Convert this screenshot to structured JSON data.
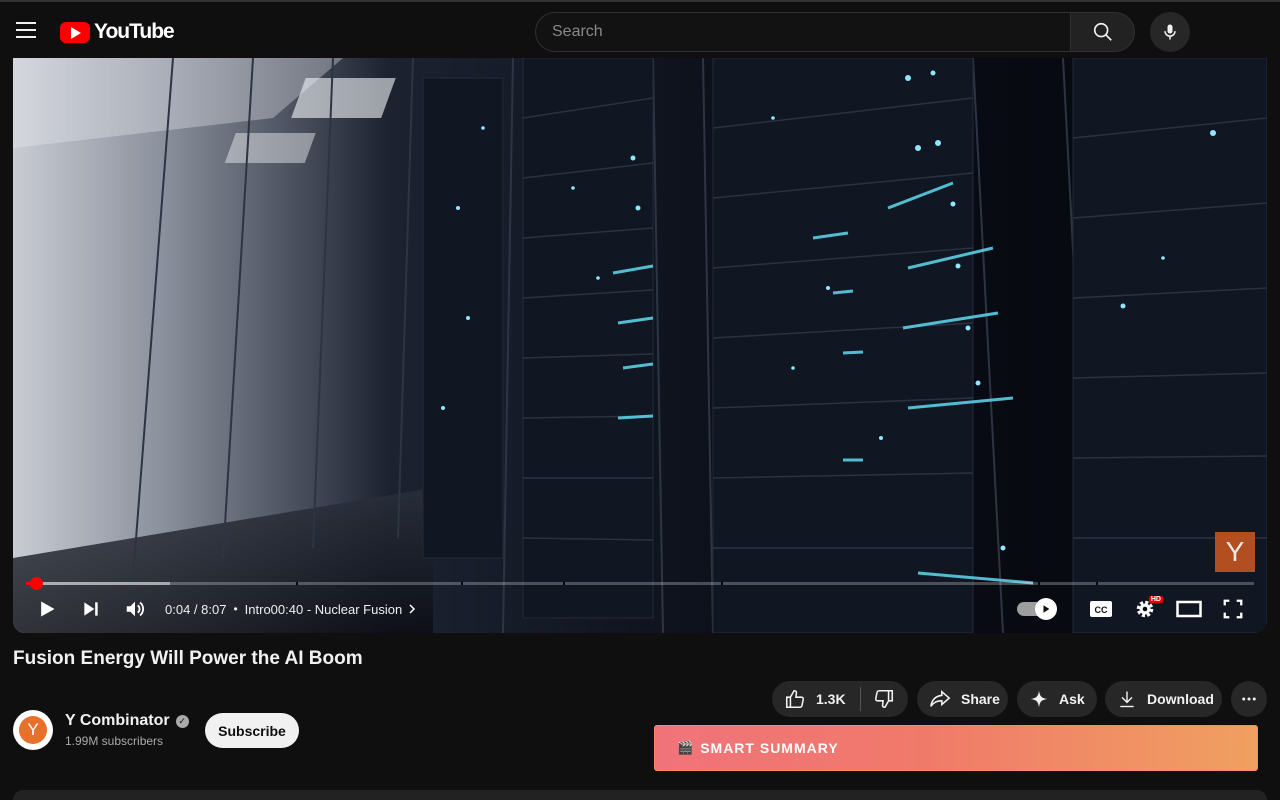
{
  "header": {
    "logo_text": "YouTube",
    "menu_icon": "hamburger-menu-icon",
    "search": {
      "placeholder": "Search",
      "value": ""
    },
    "search_icon": "search-icon",
    "mic_icon": "microphone-icon"
  },
  "player": {
    "watermark_letter": "Y",
    "progress": {
      "played_fraction": 0.008,
      "buffered_fraction": 0.117
    },
    "time": "0:04 / 8:07",
    "separator": "•",
    "chapter": "Intro00:40 - Nuclear Fusion",
    "hd_label": "HD",
    "icons": {
      "play": "play-icon",
      "next": "next-icon",
      "volume": "volume-icon",
      "chapter_chevron": "chevron-right-icon",
      "autoplay": "autoplay-toggle-icon",
      "captions": "captions-icon",
      "settings": "settings-gear-icon",
      "theater": "theater-mode-icon",
      "fullscreen": "fullscreen-icon"
    }
  },
  "video": {
    "title": "Fusion Energy Will Power the AI Boom"
  },
  "channel": {
    "avatar_letter": "Y",
    "name": "Y Combinator",
    "verified_mark": "✓",
    "subscribers": "1.99M subscribers",
    "subscribe_label": "Subscribe"
  },
  "actions": {
    "like_count": "1.3K",
    "share_label": "Share",
    "ask_label": "Ask",
    "download_label": "Download",
    "more_icon": "more-horizontal-icon"
  },
  "smart_summary": {
    "icon": "🎬",
    "label": "SMART SUMMARY"
  },
  "colors": {
    "accent_red": "#ff0000",
    "background": "#0f0f0f",
    "pill_bg": "#272727",
    "smart_summary_gradient_start": "#f0737a",
    "smart_summary_gradient_end": "#f0a060"
  }
}
